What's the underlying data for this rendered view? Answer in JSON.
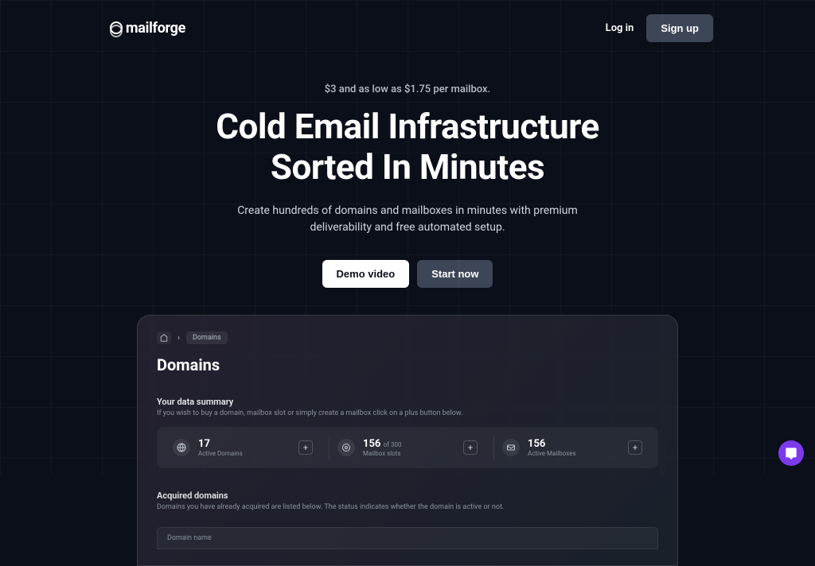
{
  "header": {
    "brand": "mailforge",
    "login": "Log in",
    "signup": "Sign up"
  },
  "hero": {
    "eyebrow": "$3 and as low as $1.75 per mailbox.",
    "title_line1": "Cold Email Infrastructure",
    "title_line2": "Sorted In Minutes",
    "subtitle_line1": "Create hundreds of domains and mailboxes in minutes with premium",
    "subtitle_line2": "deliverability and free automated setup.",
    "cta_demo": "Demo video",
    "cta_start": "Start now"
  },
  "screenshot": {
    "breadcrumb": {
      "chevron": "›",
      "current": "Domains"
    },
    "title": "Domains",
    "summary": {
      "heading": "Your data summary",
      "sub": "If you wish to buy a domain, mailbox slot or simply create a mailbox click on a plus button below."
    },
    "cards": [
      {
        "icon": "globe",
        "value": "17",
        "suffix": "",
        "label": "Active Domains"
      },
      {
        "icon": "mail-slot",
        "value": "156",
        "suffix": "of 300",
        "label": "Mailbox slots"
      },
      {
        "icon": "mailbox",
        "value": "156",
        "suffix": "",
        "label": "Active Mailboxes"
      }
    ],
    "acquired": {
      "heading": "Acquired domains",
      "sub": "Domains you have already acquired are listed below. The status indicates whether the domain is active or not."
    },
    "table": {
      "col_domain": "Domain name"
    }
  }
}
